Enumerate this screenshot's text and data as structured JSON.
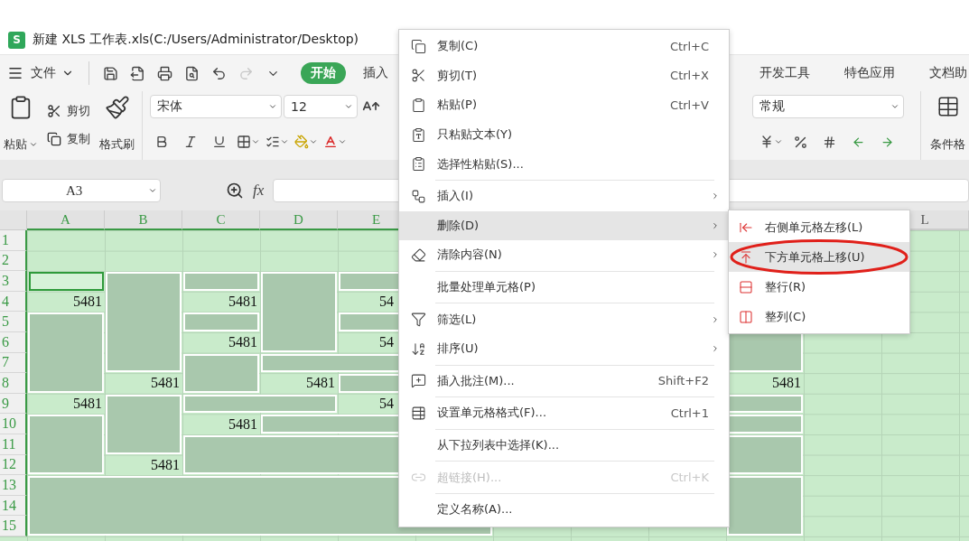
{
  "window": {
    "logo": "S",
    "title": "新建 XLS 工作表.xls(C:/Users/Administrator/Desktop)"
  },
  "menu_bar": {
    "file_label": "文件",
    "redo_disabled": true,
    "tabs": [
      {
        "label": "开始",
        "selected": true
      },
      {
        "label": "插入",
        "selected": false
      },
      {
        "label": "开发工具",
        "selected": false
      },
      {
        "label": "特色应用",
        "selected": false
      },
      {
        "label": "文档助",
        "selected": false
      }
    ]
  },
  "ribbon": {
    "paste": "粘贴",
    "cut": "剪切",
    "copy": "复制",
    "format_painter": "格式刷",
    "font": "宋体",
    "font_size": "12",
    "number_format": "常规",
    "conditional_format": "条件格"
  },
  "formula_bar": {
    "name_box": "A3",
    "fx": "fx"
  },
  "sheet": {
    "columns": [
      {
        "label": "A",
        "selected": true
      },
      {
        "label": "B",
        "selected": true
      },
      {
        "label": "C",
        "selected": true
      },
      {
        "label": "D",
        "selected": true
      },
      {
        "label": "E",
        "selected": true
      },
      {
        "label": "L",
        "selected": false
      }
    ],
    "rows": [
      {
        "label": "1",
        "selected": true
      },
      {
        "label": "2",
        "selected": true
      },
      {
        "label": "3",
        "selected": true
      },
      {
        "label": "4",
        "selected": true
      },
      {
        "label": "5",
        "selected": true
      },
      {
        "label": "6",
        "selected": true
      },
      {
        "label": "7",
        "selected": true
      },
      {
        "label": "8",
        "selected": true
      },
      {
        "label": "9",
        "selected": true
      },
      {
        "label": "10",
        "selected": true
      },
      {
        "label": "11",
        "selected": true
      },
      {
        "label": "12",
        "selected": true
      },
      {
        "label": "13",
        "selected": true
      },
      {
        "label": "14",
        "selected": true
      },
      {
        "label": "15",
        "selected": true
      }
    ],
    "values": [
      "5481",
      "5481",
      "54",
      "5481",
      "54",
      "5481",
      "5481",
      "5481",
      "5481",
      "54",
      "5481",
      "5481"
    ]
  },
  "context_menu": {
    "items": [
      {
        "label": "复制(C)",
        "shortcut": "Ctrl+C",
        "submenu": false,
        "selected": false,
        "disabled": false,
        "divider_above": false
      },
      {
        "label": "剪切(T)",
        "shortcut": "Ctrl+X",
        "submenu": false,
        "selected": false,
        "disabled": false,
        "divider_above": false
      },
      {
        "label": "粘贴(P)",
        "shortcut": "Ctrl+V",
        "submenu": false,
        "selected": false,
        "disabled": false,
        "divider_above": false
      },
      {
        "label": "只粘贴文本(Y)",
        "submenu": false,
        "selected": false,
        "disabled": false,
        "divider_above": false
      },
      {
        "label": "选择性粘贴(S)...",
        "submenu": false,
        "selected": false,
        "disabled": false,
        "divider_above": false
      },
      {
        "label": "插入(I)",
        "submenu": true,
        "selected": false,
        "disabled": false,
        "divider_above": true
      },
      {
        "label": "删除(D)",
        "submenu": true,
        "selected": true,
        "disabled": false,
        "divider_above": false
      },
      {
        "label": "清除内容(N)",
        "submenu": true,
        "selected": false,
        "disabled": false,
        "divider_above": false
      },
      {
        "label": "批量处理单元格(P)",
        "submenu": false,
        "selected": false,
        "disabled": false,
        "divider_above": true
      },
      {
        "label": "筛选(L)",
        "submenu": true,
        "selected": false,
        "disabled": false,
        "divider_above": true
      },
      {
        "label": "排序(U)",
        "submenu": true,
        "selected": false,
        "disabled": false,
        "divider_above": false
      },
      {
        "label": "插入批注(M)...",
        "shortcut": "Shift+F2",
        "submenu": false,
        "selected": false,
        "disabled": false,
        "divider_above": true
      },
      {
        "label": "设置单元格格式(F)...",
        "shortcut": "Ctrl+1",
        "submenu": false,
        "selected": false,
        "disabled": false,
        "divider_above": true
      },
      {
        "label": "从下拉列表中选择(K)...",
        "submenu": false,
        "selected": false,
        "disabled": false,
        "divider_above": true
      },
      {
        "label": "超链接(H)...",
        "shortcut": "Ctrl+K",
        "submenu": false,
        "selected": false,
        "disabled": true,
        "divider_above": true
      },
      {
        "label": "定义名称(A)...",
        "submenu": false,
        "selected": false,
        "disabled": false,
        "divider_above": true
      }
    ]
  },
  "submenu": {
    "items": [
      {
        "label": "右侧单元格左移(L)",
        "selected": false,
        "circled": false
      },
      {
        "label": "下方单元格上移(U)",
        "selected": true,
        "circled": true
      },
      {
        "label": "整行(R)",
        "selected": false,
        "circled": false
      },
      {
        "label": "整列(C)",
        "selected": false,
        "circled": false
      }
    ]
  }
}
